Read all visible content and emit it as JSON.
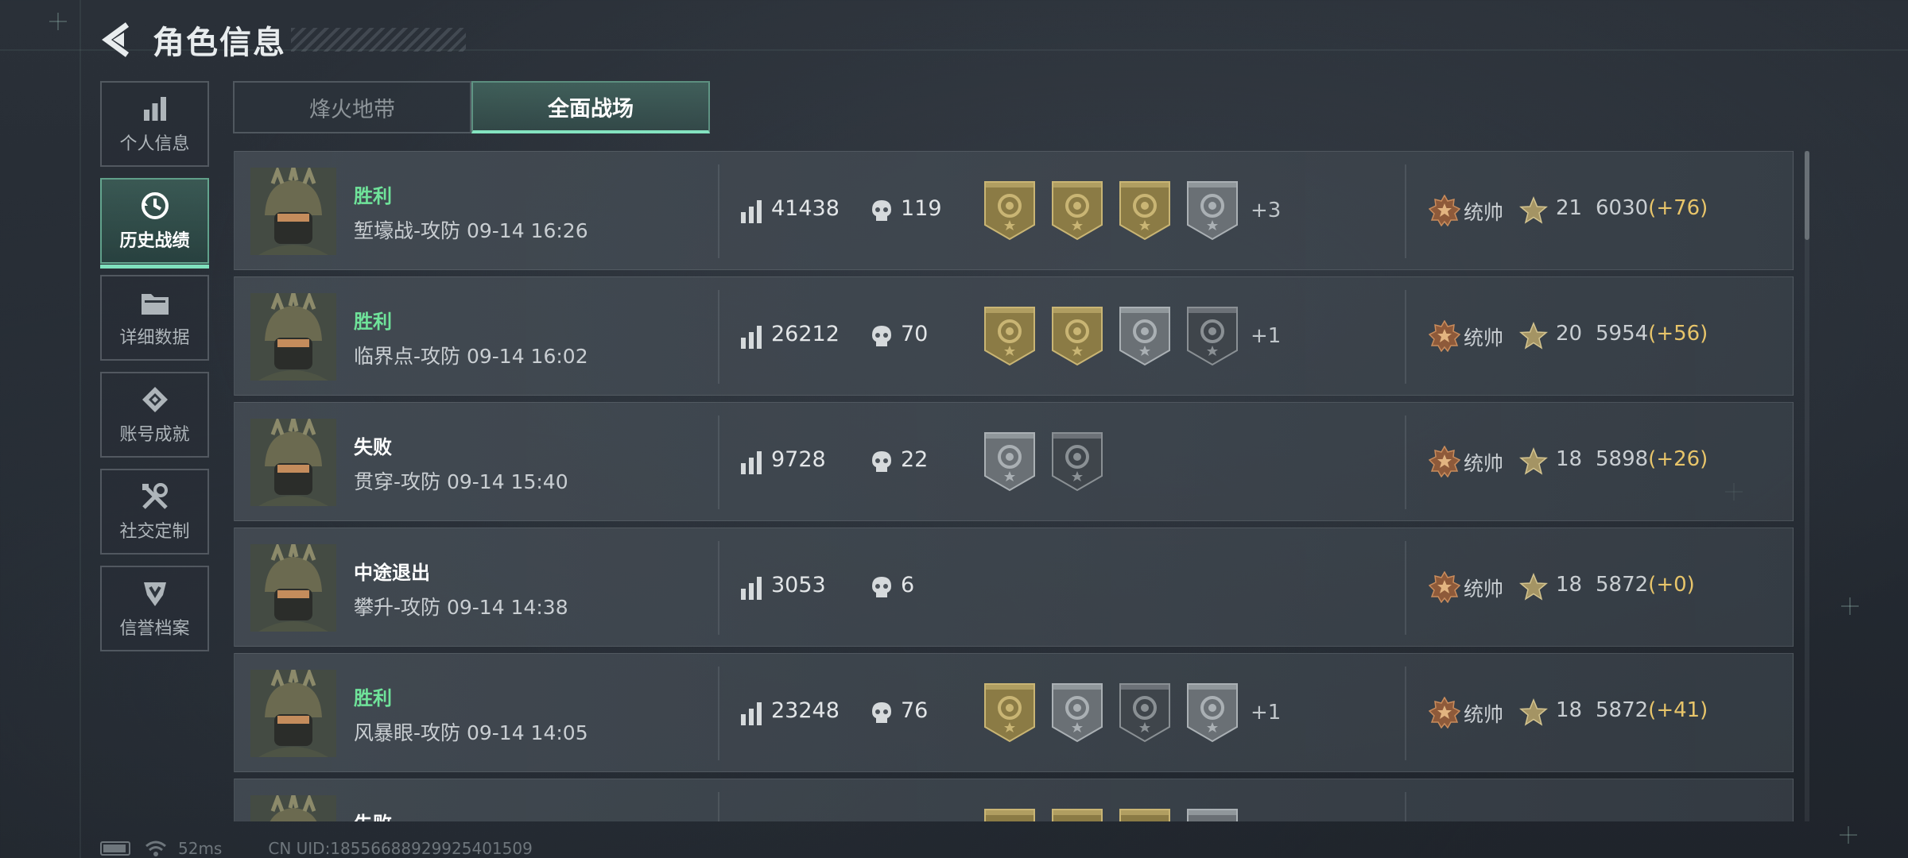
{
  "header": {
    "title": "角色信息"
  },
  "sidebar": {
    "items": [
      {
        "label": "个人信息",
        "icon": "bar-chart-icon",
        "active": false
      },
      {
        "label": "历史战绩",
        "icon": "history-clock-icon",
        "active": true
      },
      {
        "label": "详细数据",
        "icon": "folder-icon",
        "active": false
      },
      {
        "label": "账号成就",
        "icon": "achievement-icon",
        "active": false
      },
      {
        "label": "社交定制",
        "icon": "tools-icon",
        "active": false
      },
      {
        "label": "信誉档案",
        "icon": "credit-shield-icon",
        "active": false
      }
    ]
  },
  "tabs": [
    {
      "label": "烽火地带",
      "active": false
    },
    {
      "label": "全面战场",
      "active": true
    }
  ],
  "records": [
    {
      "result": "胜利",
      "result_type": "win",
      "map": "堑壕战-攻防 09-14 16:26",
      "score": "41438",
      "kills": "119",
      "medals": [
        "gold",
        "gold",
        "gold",
        "silver"
      ],
      "more": "+3",
      "rank": "统帅",
      "level": "21",
      "points": "6030",
      "delta": "(+76)"
    },
    {
      "result": "胜利",
      "result_type": "win",
      "map": "临界点-攻防 09-14 16:02",
      "score": "26212",
      "kills": "70",
      "medals": [
        "gold",
        "gold",
        "silver",
        "dark"
      ],
      "more": "+1",
      "rank": "统帅",
      "level": "20",
      "points": "5954",
      "delta": "(+56)"
    },
    {
      "result": "失败",
      "result_type": "lose",
      "map": "贯穿-攻防 09-14 15:40",
      "score": "9728",
      "kills": "22",
      "medals": [
        "silver",
        "dark"
      ],
      "more": "",
      "rank": "统帅",
      "level": "18",
      "points": "5898",
      "delta": "(+26)"
    },
    {
      "result": "中途退出",
      "result_type": "quit",
      "map": "攀升-攻防 09-14 14:38",
      "score": "3053",
      "kills": "6",
      "medals": [],
      "more": "",
      "rank": "统帅",
      "level": "18",
      "points": "5872",
      "delta": "(+0)"
    },
    {
      "result": "胜利",
      "result_type": "win",
      "map": "风暴眼-攻防 09-14 14:05",
      "score": "23248",
      "kills": "76",
      "medals": [
        "gold",
        "silver",
        "dark",
        "silver"
      ],
      "more": "+1",
      "rank": "统帅",
      "level": "18",
      "points": "5872",
      "delta": "(+41)"
    },
    {
      "result": "失败",
      "result_type": "lose",
      "map": "",
      "score": "",
      "kills": "",
      "medals": [
        "gold",
        "gold",
        "gold",
        "silver"
      ],
      "more": "",
      "rank": "",
      "level": "",
      "points": "",
      "delta": ""
    }
  ],
  "status_bar": {
    "ping": "52ms",
    "uid": "CN UID:18556688929925401509"
  },
  "colors": {
    "accent": "#84e3c0",
    "win": "#6fe39a",
    "delta": "#e8c56a",
    "gold_medal": "#8a7a45",
    "silver_medal": "#6d7378"
  }
}
